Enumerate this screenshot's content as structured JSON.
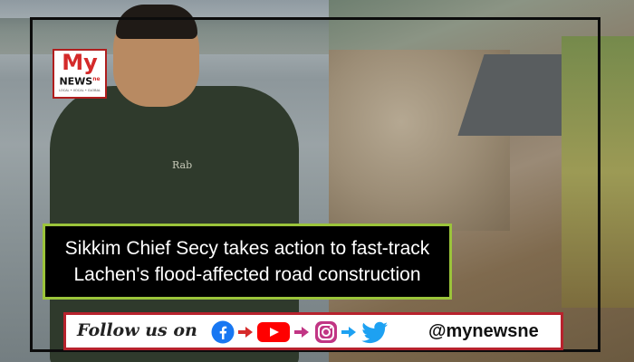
{
  "logo": {
    "top": "My",
    "middle": "NEWS",
    "sup": "ne",
    "sub": "LOCAL • VOCAL • GLOBAL"
  },
  "jacket_brand": "Rab",
  "headline": {
    "line1": "Sikkim Chief Secy takes action to fast-track",
    "line2": "Lachen's flood-affected road construction"
  },
  "follow": {
    "text": "Follow us on",
    "handle": "@mynewsne",
    "icons": [
      "facebook-icon",
      "youtube-icon",
      "instagram-icon",
      "twitter-icon"
    ],
    "colors": {
      "facebook": "#1877f2",
      "youtube": "#ff0000",
      "instagram": "#c13584",
      "twitter": "#1da1f2",
      "arrow": "#d62a2a"
    }
  },
  "colors": {
    "headline_border": "#9bc43a",
    "follow_border": "#b7222d",
    "logo_red": "#d42a2a"
  }
}
